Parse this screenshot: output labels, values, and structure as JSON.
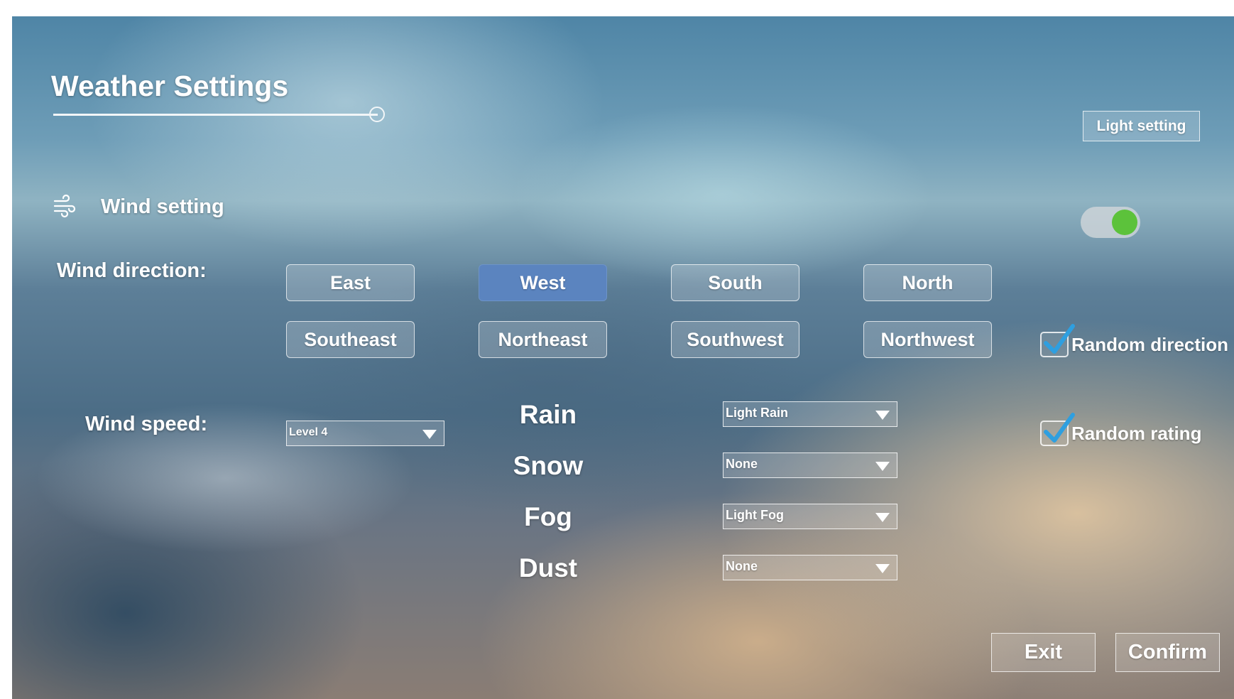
{
  "header": {
    "title": "Weather Settings",
    "light_setting_label": "Light setting"
  },
  "wind": {
    "section_label": "Wind setting",
    "icon": "wind-icon",
    "toggle_on": true,
    "direction_label": "Wind direction:",
    "directions": [
      "East",
      "West",
      "South",
      "North",
      "Southeast",
      "Northeast",
      "Southwest",
      "Northwest"
    ],
    "selected_direction": "West",
    "random_direction_label": "Random direction",
    "random_direction_checked": true,
    "speed_label": "Wind speed:",
    "speed_value": "Level 4",
    "random_rating_label": "Random rating",
    "random_rating_checked": true
  },
  "weather": [
    {
      "label": "Rain",
      "value": "Light Rain"
    },
    {
      "label": "Snow",
      "value": "None"
    },
    {
      "label": "Fog",
      "value": "Light Fog"
    },
    {
      "label": "Dust",
      "value": "None"
    }
  ],
  "footer": {
    "exit_label": "Exit",
    "confirm_label": "Confirm"
  },
  "colors": {
    "accent": "#5b84bf",
    "toggle_on": "#5cc23b",
    "checkmark": "#2e9fe0"
  }
}
